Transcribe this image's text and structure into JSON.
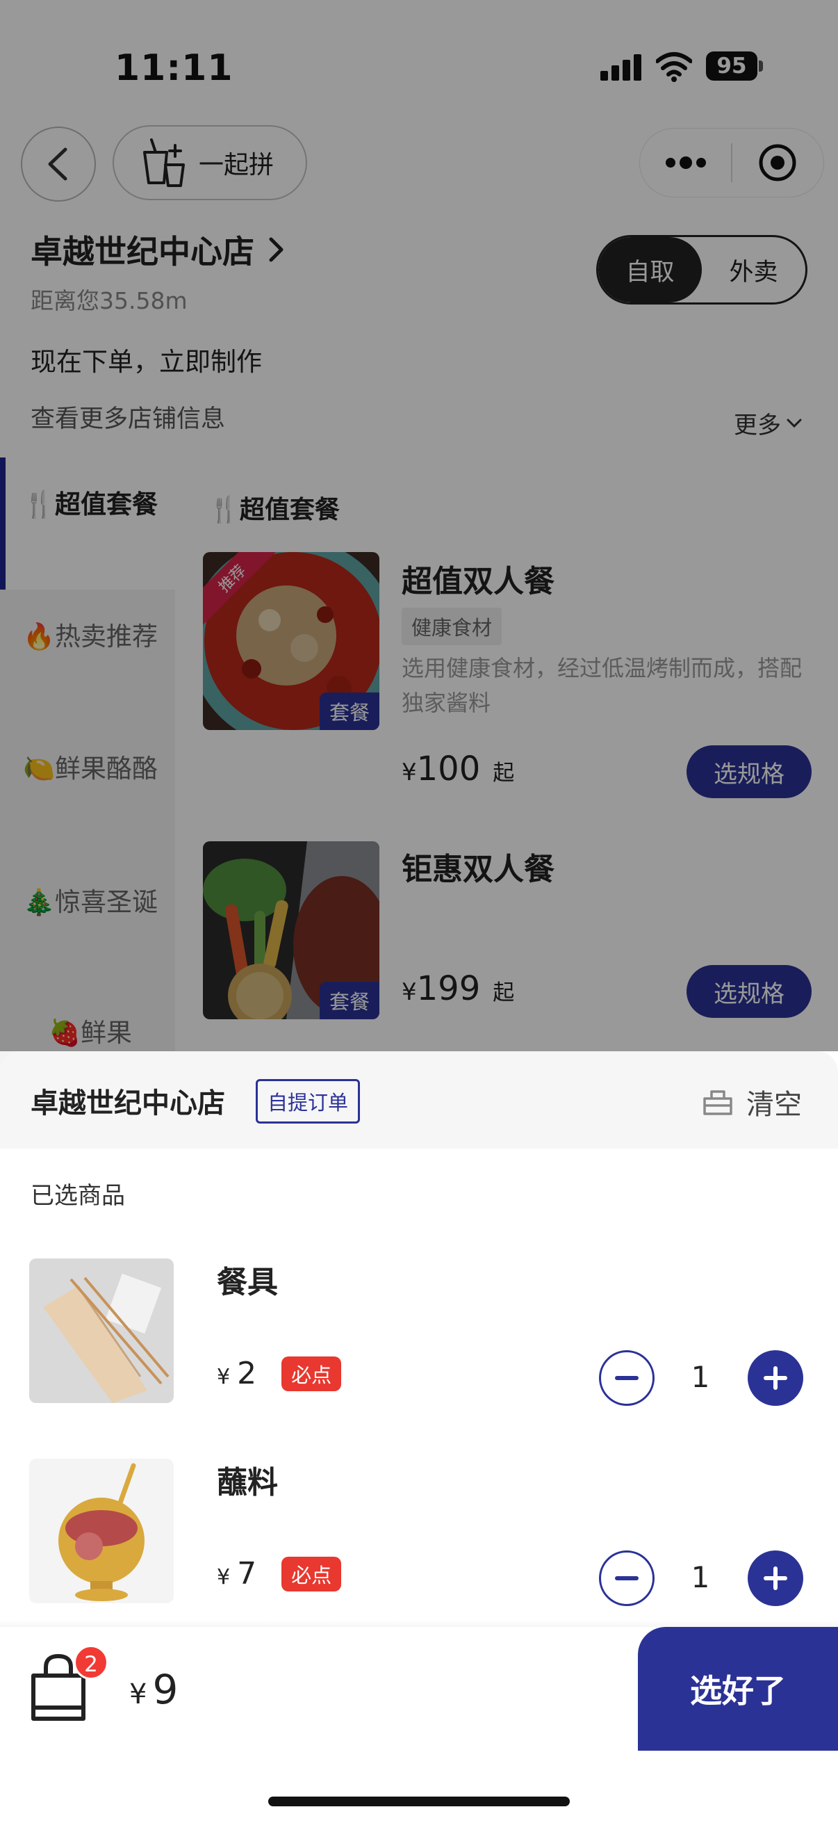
{
  "status_bar": {
    "time": "11:11",
    "battery": "95"
  },
  "nav": {
    "group_order_label": "一起拼"
  },
  "store": {
    "name": "卓越世纪中心店",
    "distance": "距离您35.58m",
    "notice": "现在下单，立即制作",
    "more_info": "查看更多店铺信息",
    "more_label": "更多"
  },
  "order_mode": {
    "options": [
      "自取",
      "外卖"
    ],
    "selected": "自取"
  },
  "categories": [
    {
      "label": "🍴超值套餐",
      "active": true
    },
    {
      "label": "🔥热卖推荐",
      "active": false
    },
    {
      "label": "🍋鲜果酪酪",
      "active": false
    },
    {
      "label": "🎄惊喜圣诞",
      "active": false
    },
    {
      "label": "🍓鲜果",
      "active": false
    }
  ],
  "section_title": "🍴超值套餐",
  "products": [
    {
      "name": "超值双人餐",
      "badge": "健康食材",
      "description": "选用健康食材，经过低温烤制而成，搭配独家酱料",
      "currency": "¥",
      "price": "100",
      "price_suffix": "起",
      "image_tag": "套餐",
      "ribbon": "推荐",
      "button_label": "选规格"
    },
    {
      "name": "钜惠双人餐",
      "currency": "¥",
      "price": "199",
      "price_suffix": "起",
      "image_tag": "套餐",
      "button_label": "选规格"
    }
  ],
  "cart": {
    "store_name": "卓越世纪中心店",
    "order_type": "自提订单",
    "clear_label": "清空",
    "selected_label": "已选商品",
    "items": [
      {
        "name": "餐具",
        "currency": "¥",
        "price": "2",
        "tag": "必点",
        "quantity": "1"
      },
      {
        "name": "蘸料",
        "currency": "¥",
        "price": "7",
        "tag": "必点",
        "quantity": "1"
      }
    ]
  },
  "checkout": {
    "item_count": "2",
    "currency": "¥",
    "total": "9",
    "button_label": "选好了"
  },
  "colors": {
    "primary": "#2b3296",
    "badge_red": "#e8382f",
    "overlay": "rgba(0,0,0,0.40)"
  }
}
